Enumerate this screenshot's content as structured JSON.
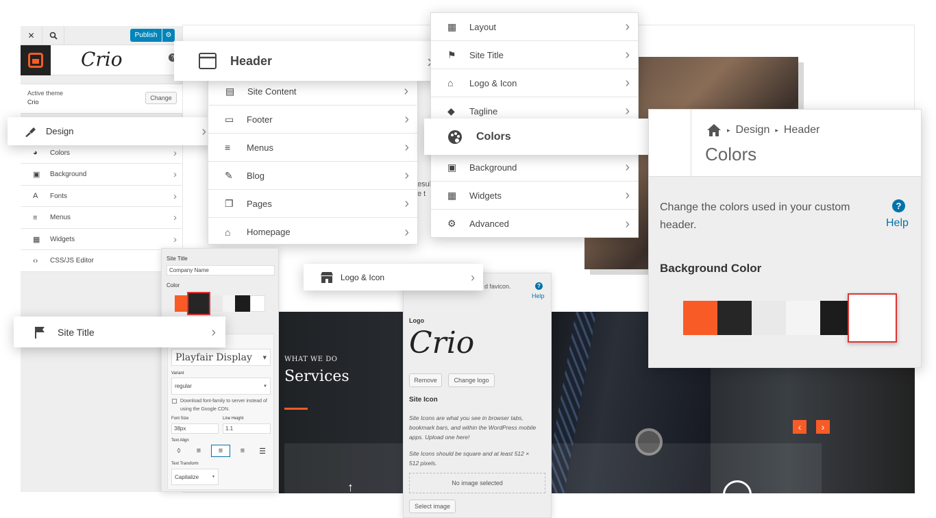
{
  "customizer": {
    "close_label": "✕",
    "publish_label": "Publish",
    "logo_text": "Crio",
    "help_mark": "?",
    "active_theme_label": "Active theme",
    "active_theme_name": "Crio",
    "change_label": "Change",
    "menu_items": [
      {
        "label": "Colors",
        "icon": "palette-icon"
      },
      {
        "label": "Background",
        "icon": "image-icon"
      },
      {
        "label": "Fonts",
        "icon": "font-icon"
      },
      {
        "label": "Menus",
        "icon": "menu-icon"
      },
      {
        "label": "Widgets",
        "icon": "widgets-icon"
      },
      {
        "label": "CSS/JS Editor",
        "icon": "code-icon"
      }
    ]
  },
  "design_card": {
    "label": "Design",
    "icon": "brush-icon"
  },
  "header_card": {
    "label": "Header",
    "icon": "header-icon"
  },
  "sections_panel": {
    "items": [
      {
        "label": "Site Content",
        "icon": "content-icon"
      },
      {
        "label": "Footer",
        "icon": "footer-icon"
      },
      {
        "label": "Menus",
        "icon": "menu-icon"
      },
      {
        "label": "Blog",
        "icon": "pin-icon"
      },
      {
        "label": "Pages",
        "icon": "pages-icon"
      },
      {
        "label": "Homepage",
        "icon": "home-icon"
      }
    ]
  },
  "header_panel": {
    "items": [
      {
        "label": "Layout",
        "icon": "layout-icon"
      },
      {
        "label": "Site Title",
        "icon": "flag-icon"
      },
      {
        "label": "Logo & Icon",
        "icon": "store-icon"
      },
      {
        "label": "Tagline",
        "icon": "tag-icon"
      },
      {
        "label": "Background",
        "icon": "image-icon"
      },
      {
        "label": "Widgets",
        "icon": "widgets-icon"
      },
      {
        "label": "Advanced",
        "icon": "gear-icon"
      }
    ]
  },
  "colors_card": {
    "label": "Colors",
    "icon": "palette-icon"
  },
  "colors_panel": {
    "breadcrumb": [
      "Design",
      "Header"
    ],
    "title": "Colors",
    "description": "Change the colors used in your custom header.",
    "help_label": "Help",
    "section_title": "Background Color",
    "swatches": [
      "#f95b26",
      "#262626",
      "#e9e9e9",
      "#f4f4f4",
      "#1c1c1c",
      "#ffffff"
    ],
    "selected_index": 5
  },
  "site_title_card": {
    "label": "Site Title",
    "icon": "flag-icon"
  },
  "typography_panel": {
    "site_title_label": "Site Title",
    "site_title_value": "Company Name",
    "color_label": "Color",
    "font_family": "Playfair Display",
    "variant_label": "Variant",
    "variant_value": "regular",
    "download_label": "Download font-family to server instead of using the Google CDN.",
    "font_size_label": "Font Size",
    "font_size_value": "38px",
    "line_height_label": "Line Height",
    "line_height_value": "1.1",
    "text_align_label": "Text Align",
    "text_transform_label": "Text Transform",
    "text_transform_value": "Capitalize"
  },
  "logo_card": {
    "label": "Logo & Icon",
    "icon": "store-icon"
  },
  "logo_panel": {
    "top_text": "d favicon.",
    "help_label": "Help",
    "logo_label": "Logo",
    "logo_text": "Crio",
    "remove_label": "Remove",
    "change_logo_label": "Change logo",
    "site_icon_label": "Site Icon",
    "site_icon_desc_1": "Site Icons are what you see in browser tabs, bookmark bars, and within the WordPress mobile apps. Upload one here!",
    "site_icon_desc_2": "Site Icons should be square and at least 512 × 512 pixels.",
    "no_image_label": "No image selected",
    "select_image_label": "Select image"
  },
  "preview": {
    "kicker": "WHAT WE DO",
    "heading": "Services",
    "snippet_1": "t",
    "snippet_2": "esul",
    "snippet_3": "e t"
  },
  "colors": {
    "accent": "#f95b26",
    "wp_blue": "#0085ba",
    "dark": "#23282d"
  }
}
